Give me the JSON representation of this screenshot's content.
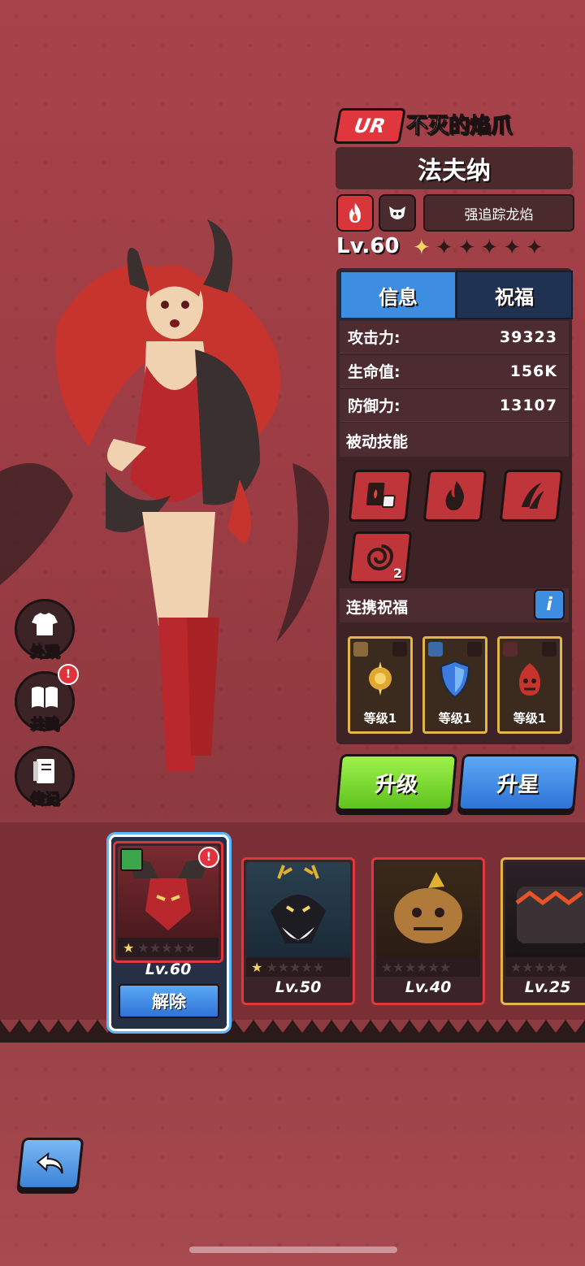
{
  "hero": {
    "rarity": "UR",
    "subtitle": "不灭的焰爪",
    "name": "法夫纳",
    "element_icon": "fire-element-icon",
    "faction_icon": "demon-faction-icon",
    "trait": "强追踪龙焰",
    "level": "Lv.60",
    "stars_filled": 1,
    "stars_total": 6
  },
  "tabs": [
    {
      "label": "信息",
      "active": true
    },
    {
      "label": "祝福",
      "active": false
    }
  ],
  "stats": [
    {
      "label": "攻击力:",
      "value": "39323"
    },
    {
      "label": "生命值:",
      "value": "156K"
    },
    {
      "label": "防御力:",
      "value": "13107"
    }
  ],
  "passive": {
    "title": "被动技能",
    "skills": [
      {
        "icon": "cards-dice-icon"
      },
      {
        "icon": "flame-icon"
      },
      {
        "icon": "claw-slash-icon"
      },
      {
        "icon": "vortex-icon",
        "count": "2"
      }
    ]
  },
  "link_bless": {
    "title": "连携祝福",
    "info_label": "i",
    "items": [
      {
        "icon": "gold-rune-icon",
        "label": "等级1"
      },
      {
        "icon": "blue-shield-icon",
        "label": "等级1"
      },
      {
        "icon": "red-demon-icon",
        "label": "等级1"
      }
    ]
  },
  "actions": {
    "upgrade": "升级",
    "star_up": "升星"
  },
  "side_menu": [
    {
      "label": "外观",
      "icon": "shirt-icon",
      "badge": ""
    },
    {
      "label": "共鸣",
      "icon": "book-icon",
      "badge": "!"
    },
    {
      "label": "传记",
      "icon": "journal-icon",
      "badge": ""
    }
  ],
  "roster": [
    {
      "level": "Lv.60",
      "stars_filled": 1,
      "selected": true,
      "action": "解除",
      "badge": "!"
    },
    {
      "level": "Lv.50",
      "stars_filled": 1,
      "selected": false
    },
    {
      "level": "Lv.40",
      "stars_filled": 0,
      "selected": false
    },
    {
      "level": "Lv.25",
      "stars_filled": 0,
      "selected": false
    }
  ],
  "colors": {
    "accent_red": "#e0363d",
    "tab_blue": "#3d8de0",
    "upgrade_green": "#7ed934",
    "gold_border": "#e2b548"
  }
}
